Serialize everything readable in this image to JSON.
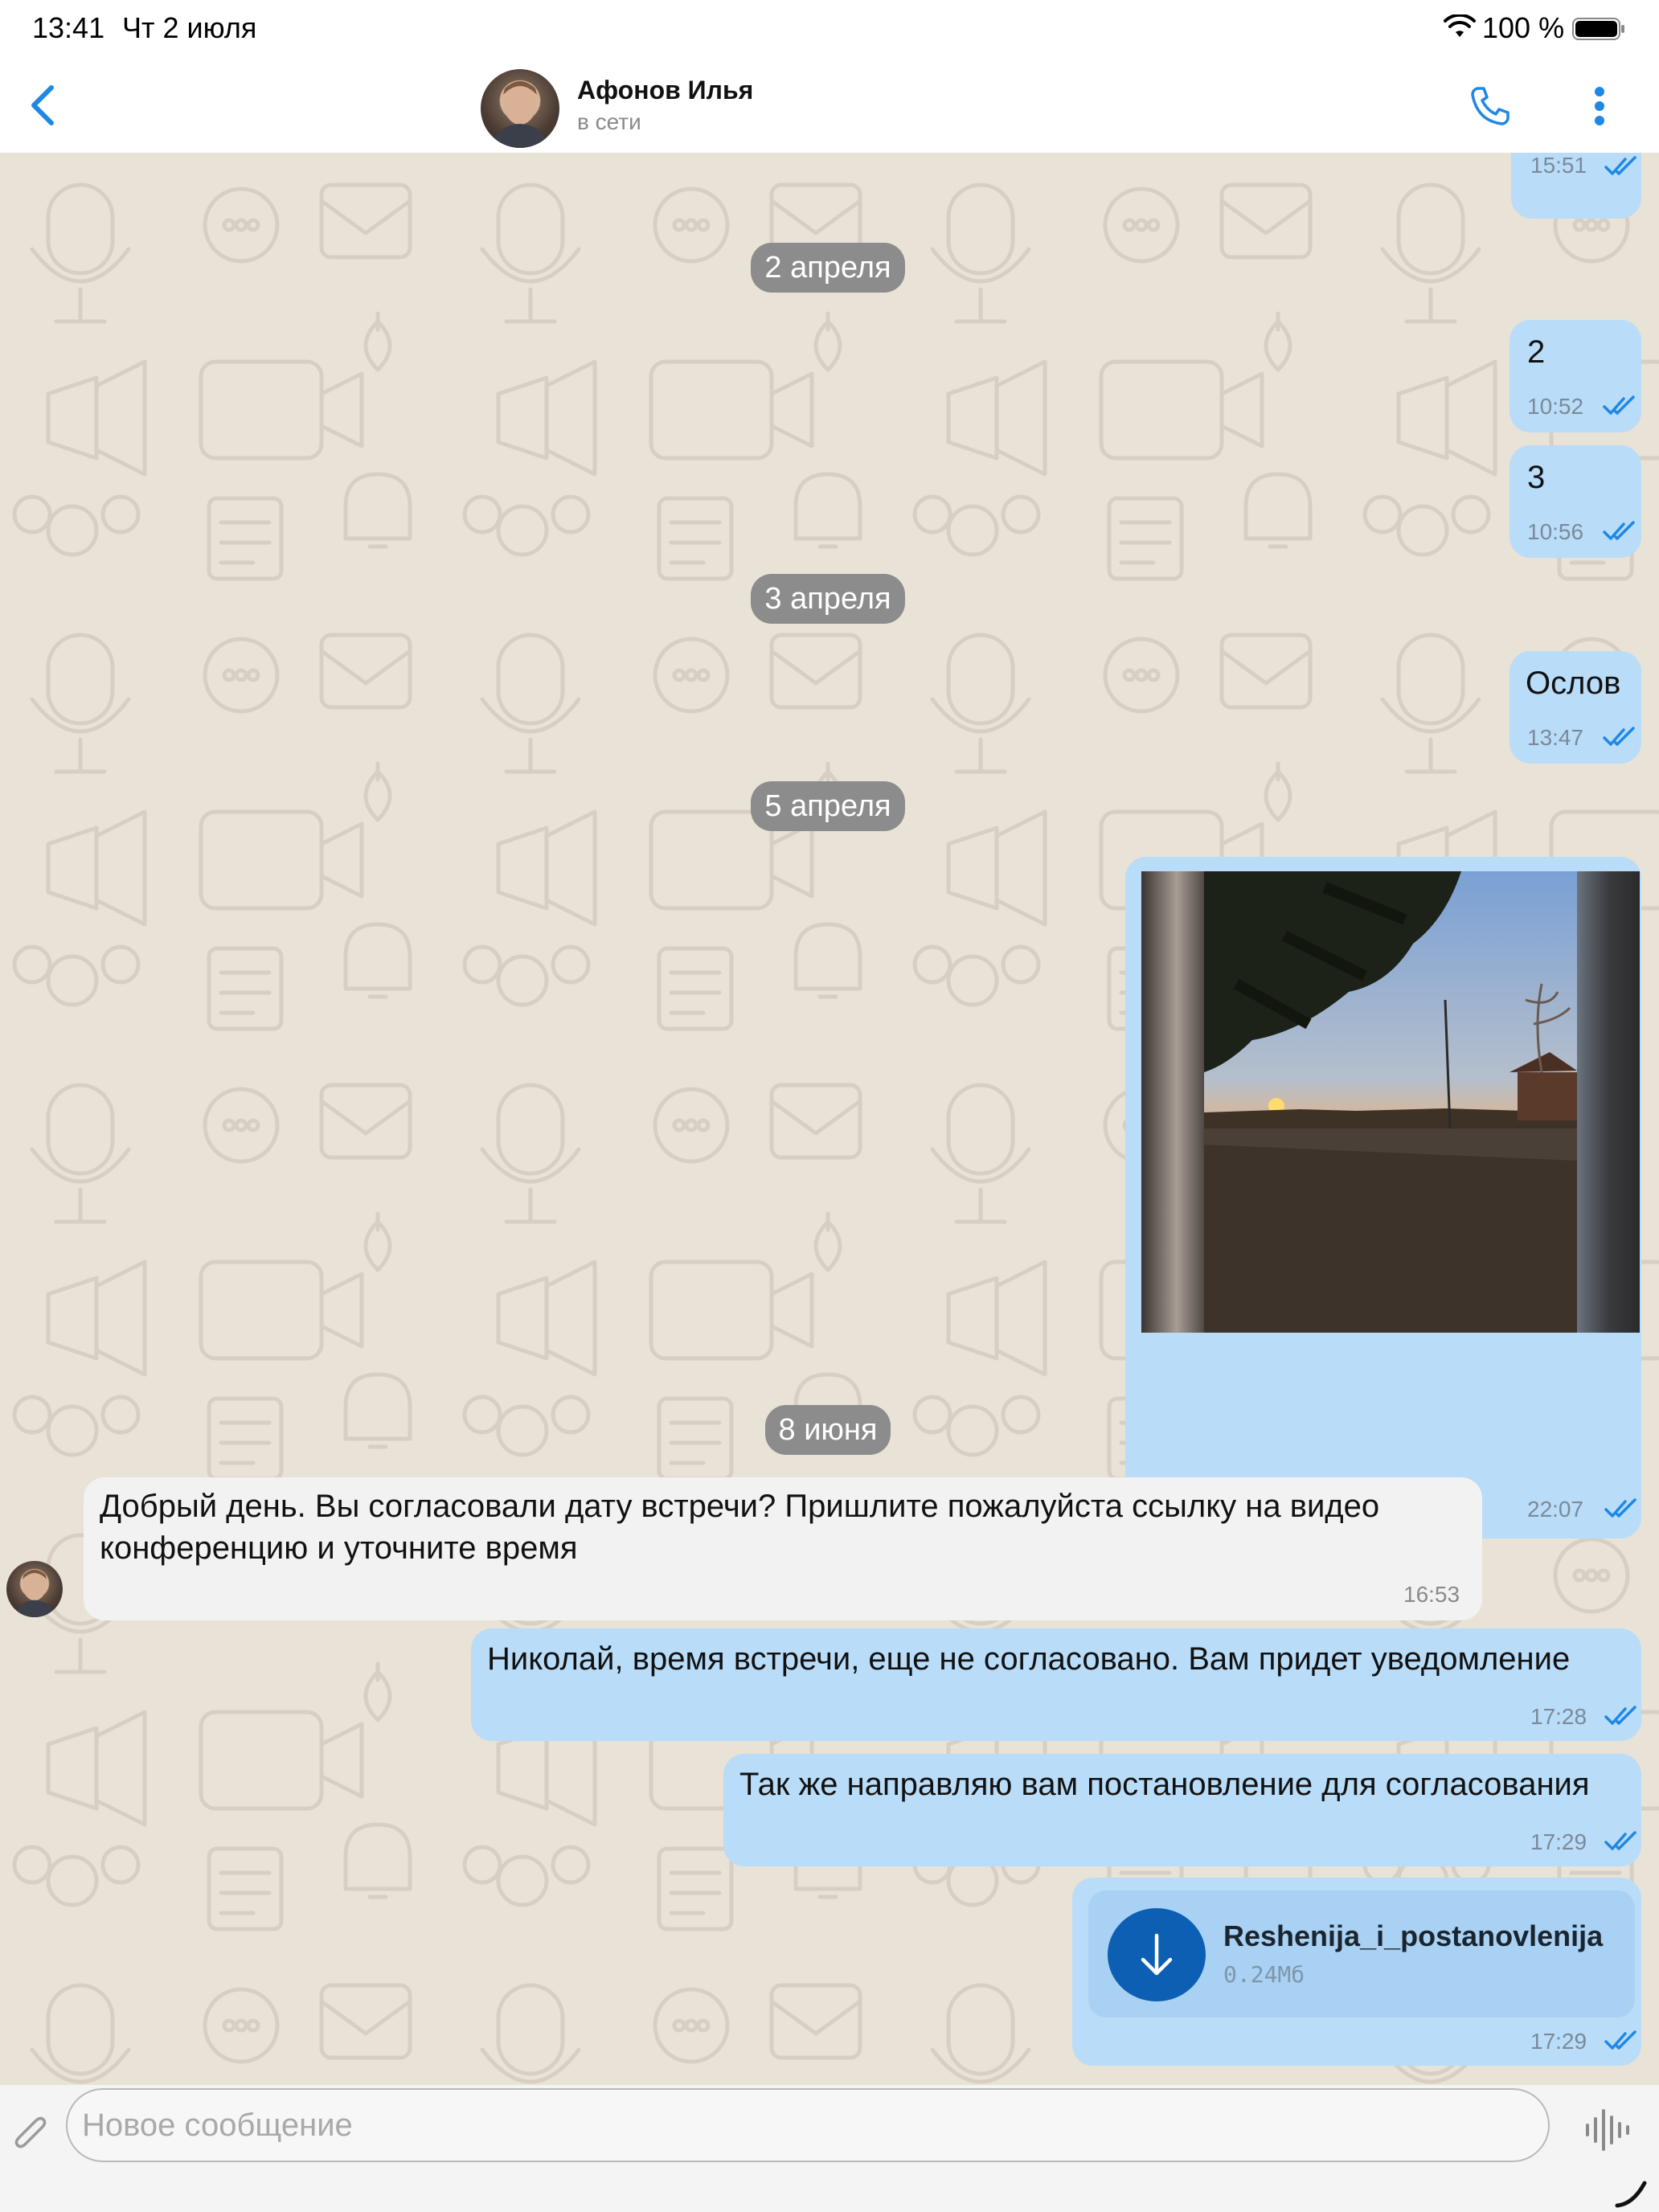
{
  "status_bar": {
    "time": "13:41",
    "date": "Чт 2 июля",
    "battery_percent": "100 %",
    "icons": [
      "wifi-icon",
      "battery-icon"
    ]
  },
  "header": {
    "contact_name": "Афонов Илья",
    "contact_status": "в сети",
    "icons": [
      "back-chevron-icon",
      "phone-icon",
      "more-vertical-icon"
    ]
  },
  "messages": {
    "m0": {
      "time": "15:51"
    },
    "d1": {
      "label": "2 апреля"
    },
    "m1": {
      "text": "2",
      "time": "10:52"
    },
    "m2": {
      "text": "3",
      "time": "10:56"
    },
    "d2": {
      "label": "3 апреля"
    },
    "m3": {
      "text": "Ослов",
      "time": "13:47"
    },
    "d3": {
      "label": "5 апреля"
    },
    "m4": {
      "time": "22:07"
    },
    "d4": {
      "label": "8 июня"
    },
    "m5": {
      "text": "Добрый день. Вы согласовали дату встречи? Пришлите пожалуйста ссылку на видео конференцию и уточните время",
      "time": "16:53"
    },
    "m6": {
      "text": "Николай, время встречи, еще не согласовано. Вам придет уведомление",
      "time": "17:28"
    },
    "m7": {
      "text": "Так же направляю вам постановление для согласования",
      "time": "17:29"
    },
    "m8": {
      "file_name": "Reshenija_i_postanovlenija",
      "file_size": "0.24Мб",
      "time": "17:29"
    }
  },
  "composer": {
    "placeholder": "Новое сообщение",
    "icons": [
      "paperclip-icon",
      "voice-wave-icon"
    ]
  },
  "colors": {
    "accent": "#1e88e5",
    "outgoing_bubble": "#b9dcf8",
    "incoming_bubble": "#f2f2f2",
    "chat_background": "#e9e2d6",
    "date_pill": "#8c8c8c",
    "download_button": "#0d5fb3"
  }
}
